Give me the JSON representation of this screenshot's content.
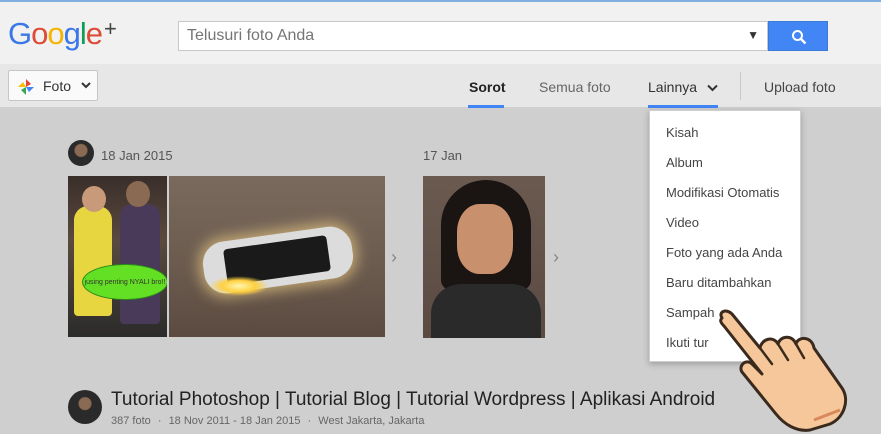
{
  "header": {
    "logo_text": "Google",
    "logo_plus": "+",
    "search_placeholder": "Telusuri foto Anda"
  },
  "subbar": {
    "foto_label": "Foto",
    "tabs": [
      {
        "label": "Sorot",
        "active": true
      },
      {
        "label": "Semua foto",
        "active": false
      },
      {
        "label": "Lainnya",
        "active": false
      }
    ],
    "upload_label": "Upload foto"
  },
  "stream": {
    "groups": [
      {
        "date": "18 Jan 2015",
        "overlay_text": "jusing penting NYALI bro!!"
      },
      {
        "date": "17 Jan"
      }
    ]
  },
  "album": {
    "title": "Tutorial Photoshop | Tutorial Blog | Tutorial Wordpress | Aplikasi Android",
    "count": "387 foto",
    "dates": "18 Nov 2011 - 18 Jan 2015",
    "location": "West Jakarta, Jakarta",
    "sep": "·"
  },
  "menu": {
    "items": [
      "Kisah",
      "Album",
      "Modifikasi Otomatis",
      "Video",
      "Foto yang ada Anda",
      "Baru ditambahkan",
      "Sampah",
      "Ikuti tur"
    ]
  },
  "colors": {
    "accent": "#4285f4",
    "header_bg": "#f1f1f1"
  }
}
